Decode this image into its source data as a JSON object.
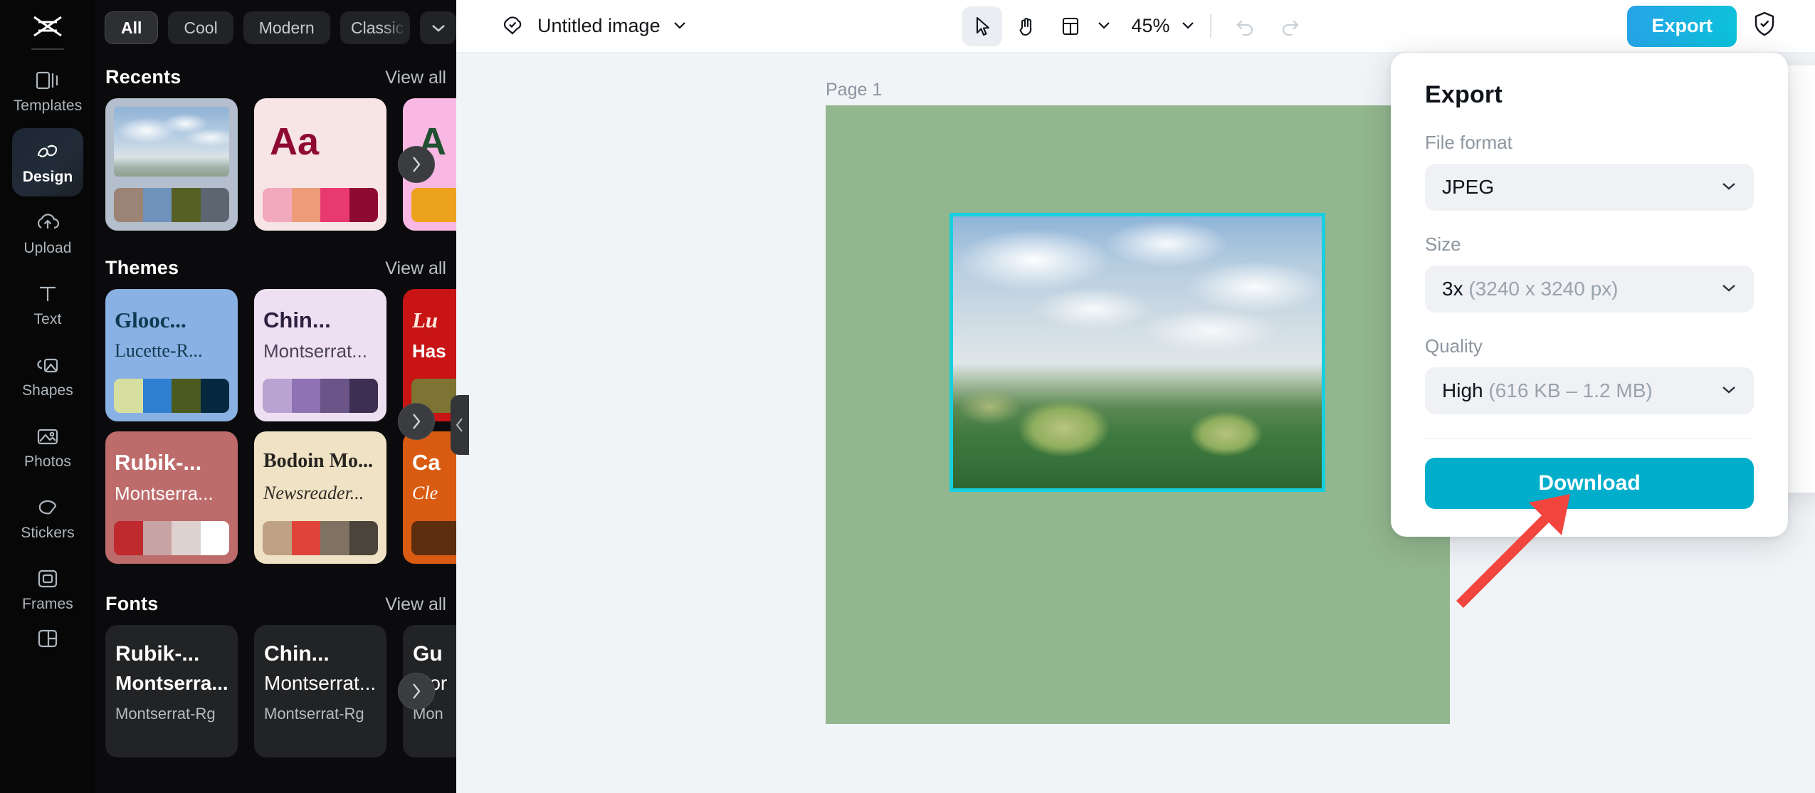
{
  "rail": {
    "logo_icon": "capcut-logo-icon",
    "items": [
      {
        "label": "Templates",
        "icon": "templates-icon",
        "active": false
      },
      {
        "label": "Design",
        "icon": "design-icon",
        "active": true
      },
      {
        "label": "Upload",
        "icon": "upload-cloud-icon",
        "active": false
      },
      {
        "label": "Text",
        "icon": "text-icon",
        "active": false
      },
      {
        "label": "Shapes",
        "icon": "shapes-icon",
        "active": false
      },
      {
        "label": "Photos",
        "icon": "photos-icon",
        "active": false
      },
      {
        "label": "Stickers",
        "icon": "stickers-icon",
        "active": false
      },
      {
        "label": "Frames",
        "icon": "frames-icon",
        "active": false
      },
      {
        "label": "Grids",
        "icon": "grids-icon",
        "active": false
      }
    ]
  },
  "panel": {
    "chips": [
      {
        "label": "All",
        "active": true
      },
      {
        "label": "Cool",
        "active": false
      },
      {
        "label": "Modern",
        "active": false
      },
      {
        "label": "Classic",
        "active": false
      }
    ],
    "chip_more_icon": "chevron-down-icon",
    "sections": [
      {
        "title": "Recents",
        "view_all": "View all",
        "cards": [
          {
            "kind": "image",
            "swatches": [
              "#9b8375",
              "#6f93bd",
              "#566025",
              "#5d6670"
            ]
          },
          {
            "kind": "aa",
            "aa_text": "Aa",
            "aa_color": "#8e0a33",
            "swatches": [
              "#f2a8bd",
              "#ee9b7a",
              "#e83a71",
              "#8e0a33"
            ]
          },
          {
            "kind": "aa",
            "aa_text": "A",
            "aa_color": "#1f5130",
            "swatches": [
              "#eda21d",
              "#eda21d",
              "#eda21d",
              "#eda21d"
            ]
          }
        ]
      },
      {
        "title": "Themes",
        "view_all": "View all",
        "cards": [
          {
            "title": "Glooc...",
            "sub": "Lucette-R...",
            "title_color": "#0e3a52",
            "sub_color": "#123a52",
            "swatches": [
              "#d6dfa0",
              "#2f7fd2",
              "#4b5a1f",
              "#06283f"
            ]
          },
          {
            "title": "Chin...",
            "sub": "Montserrat...",
            "title_color": "#2c2140",
            "sub_color": "#4a4359",
            "swatches": [
              "#b9a3d2",
              "#8f72b4",
              "#6a5488",
              "#3d2f52"
            ]
          },
          {
            "title": "Lu",
            "sub": "Has",
            "title_color": "#ffe9e0",
            "sub_color": "#ffffff",
            "swatches": [
              "#7d7434",
              "#7d7434",
              "#7d7434",
              "#7d7434"
            ]
          },
          {
            "title": "Rubik-...",
            "sub": "Montserra...",
            "title_color": "#ffffff",
            "sub_color": "#ffffff",
            "swatches": [
              "#bf2a2e",
              "#c7a3a3",
              "#ded2d1",
              "#ffffff"
            ]
          },
          {
            "title": "Bodoin Mo...",
            "sub": "Newsreader...",
            "title_color": "#262420",
            "sub_color": "#2e2b26",
            "swatches": [
              "#bfa184",
              "#e04438",
              "#7f7263",
              "#4a443a"
            ]
          },
          {
            "title": "Ca",
            "sub": "Cle",
            "title_color": "#ffffff",
            "sub_color": "#ffffff",
            "swatches": [
              "#5d2d10",
              "#5d2d10",
              "#5d2d10",
              "#5d2d10"
            ]
          }
        ]
      },
      {
        "title": "Fonts",
        "view_all": "View all",
        "cards": [
          {
            "line1": "Rubik-...",
            "line2": "Montserra...",
            "line3": "Montserrat-Rg"
          },
          {
            "line1": "Chin...",
            "line2": "Montserrat...",
            "line3": "Montserrat-Rg"
          },
          {
            "line1": "Gu",
            "line2": "Mor",
            "line3": "Mon"
          }
        ]
      }
    ],
    "carousel_next_icon": "chevron-right-icon",
    "collapse_icon": "chevron-left-icon"
  },
  "topbar": {
    "cloud_saved_icon": "cloud-check-icon",
    "doc_title": "Untitled image",
    "title_chevron_icon": "chevron-down-icon",
    "tools": [
      {
        "icon": "cursor-select-icon",
        "active": true
      },
      {
        "icon": "hand-pan-icon",
        "active": false
      },
      {
        "icon": "layout-page-icon",
        "active": false
      }
    ],
    "layout_chevron_icon": "chevron-down-icon",
    "zoom_level": "45%",
    "zoom_chevron_icon": "chevron-down-icon",
    "undo_icon": "undo-icon",
    "redo_icon": "redo-icon",
    "export_label": "Export",
    "shield_icon": "shield-check-icon"
  },
  "canvas": {
    "page_label": "Page 1",
    "artboard_color": "#92b68d",
    "selection_color": "#18cfe0",
    "photo_alt": "chocolate-hills-landscape-photo"
  },
  "export_popover": {
    "title": "Export",
    "fields": [
      {
        "label": "File format",
        "value": "JPEG",
        "detail": "",
        "chevron_icon": "chevron-down-icon"
      },
      {
        "label": "Size",
        "value": "3x",
        "detail": "(3240 x 3240 px)",
        "chevron_icon": "chevron-down-icon"
      },
      {
        "label": "Quality",
        "value": "High",
        "detail": "(616 KB – 1.2 MB)",
        "chevron_icon": "chevron-down-icon"
      }
    ],
    "download_label": "Download",
    "download_color": "#00aecb"
  },
  "annotation": {
    "arrow_icon": "red-pointer-arrow-icon",
    "arrow_color": "#f2453d"
  }
}
